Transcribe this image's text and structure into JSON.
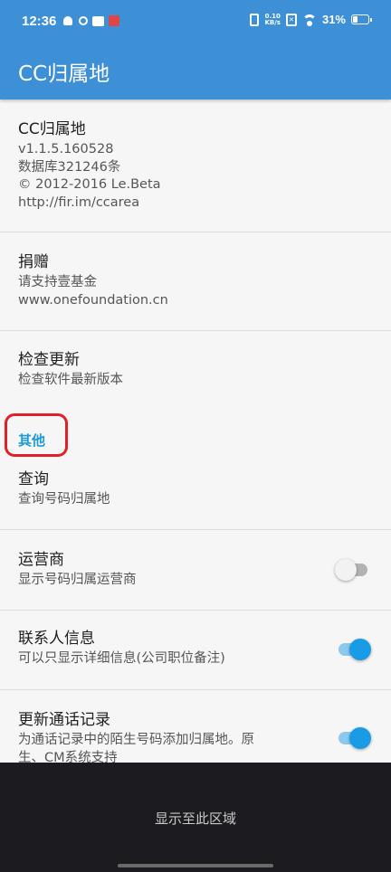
{
  "status_bar": {
    "time": "12:36",
    "net_speed_value": "0.10",
    "net_speed_unit": "KB/s",
    "sim_label": "✕",
    "battery_percent": "31%"
  },
  "app_bar": {
    "title": "CC归属地"
  },
  "about": {
    "title": "CC归属地",
    "version": "v1.1.5.160528",
    "database": "数据库321246条",
    "copyright": "© 2012-2016 Le.Beta",
    "url": "http://fir.im/ccarea"
  },
  "donate": {
    "title": "捐赠",
    "summary_line1": "请支持壹基金",
    "summary_line2": "www.onefoundation.cn"
  },
  "check_update": {
    "title": "检查更新",
    "summary": "检查软件最新版本"
  },
  "category_other": "其他",
  "query": {
    "title": "查询",
    "summary": "查询号码归属地"
  },
  "carrier": {
    "title": "运营商",
    "summary": "显示号码归属运营商",
    "enabled": false
  },
  "contact_info": {
    "title": "联系人信息",
    "summary": "可以只显示详细信息(公司职位备注)",
    "enabled": true
  },
  "update_call_log": {
    "title": "更新通话记录",
    "summary_line1": "为通话记录中的陌生号码添加归属地。原",
    "summary_line2": "生、CM系统支持",
    "enabled": true
  },
  "overlay": {
    "message": "显示至此区域"
  },
  "colors": {
    "primary": "#3d8fd6",
    "accent": "#1a9be6",
    "highlight": "#e0202a"
  }
}
